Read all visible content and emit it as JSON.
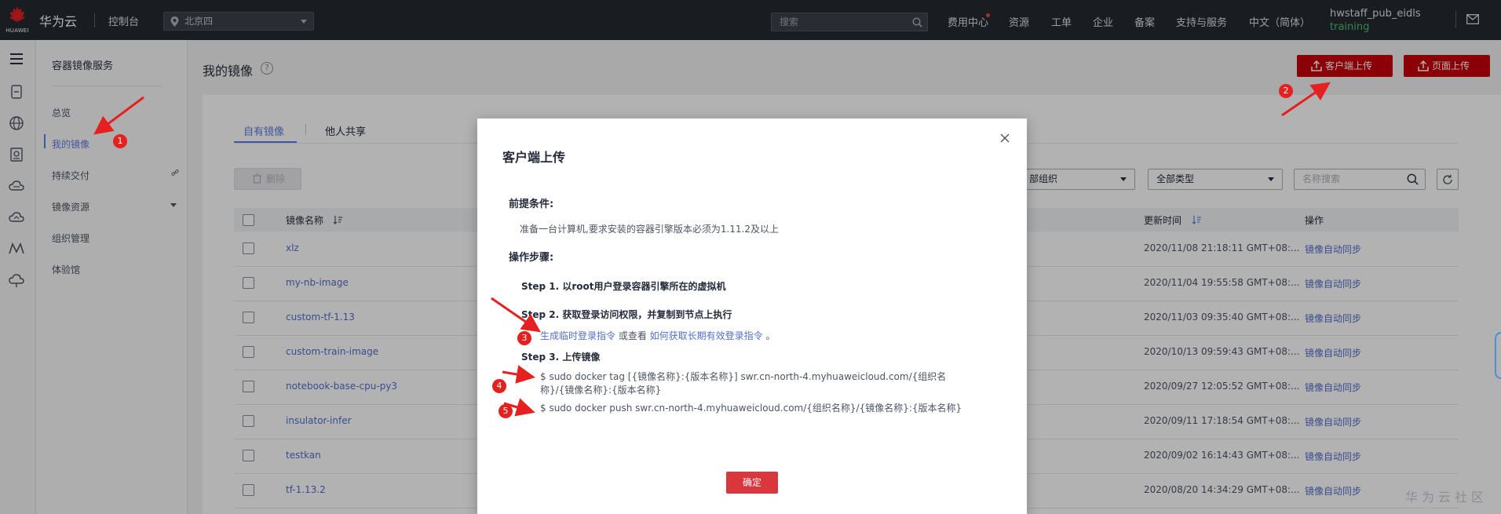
{
  "topbar": {
    "logo_text": "HUAWEI",
    "brand": "华为云",
    "console": "控制台",
    "region": "北京四",
    "search_placeholder": "搜索",
    "nav": [
      "费用中心",
      "资源",
      "工单",
      "企业",
      "备案",
      "支持与服务",
      "中文（简体）"
    ],
    "user_name": "hwstaff_pub_eidls",
    "user_role": "training"
  },
  "sidebar": {
    "title": "容器镜像服务",
    "items": [
      "总览",
      "我的镜像",
      "持续交付",
      "镜像资源",
      "组织管理",
      "体验馆"
    ],
    "active_index": 1
  },
  "main": {
    "title": "我的镜像",
    "help": "?",
    "client_upload": "客户端上传",
    "page_upload": "页面上传",
    "tabs": [
      "自有镜像",
      "他人共享"
    ],
    "delete_label": "删除",
    "org_filter": "部组织",
    "type_filter": "全部类型",
    "name_search_placeholder": "名称搜索",
    "columns": {
      "name": "镜像名称",
      "updated": "更新时间",
      "actions": "操作"
    },
    "rows": [
      {
        "name": "xlz",
        "updated": "2020/11/08 21:18:11 GMT+08:...",
        "action": "镜像自动同步"
      },
      {
        "name": "my-nb-image",
        "updated": "2020/11/04 19:55:58 GMT+08:...",
        "action": "镜像自动同步"
      },
      {
        "name": "custom-tf-1.13",
        "updated": "2020/11/03 09:35:40 GMT+08:...",
        "action": "镜像自动同步"
      },
      {
        "name": "custom-train-image",
        "updated": "2020/10/13 09:59:43 GMT+08:...",
        "action": "镜像自动同步"
      },
      {
        "name": "notebook-base-cpu-py3",
        "updated": "2020/09/27 12:05:52 GMT+08:...",
        "action": "镜像自动同步"
      },
      {
        "name": "insulator-infer",
        "updated": "2020/09/11 17:18:54 GMT+08:...",
        "action": "镜像自动同步"
      },
      {
        "name": "testkan",
        "updated": "2020/09/02 16:14:43 GMT+08:...",
        "action": "镜像自动同步"
      },
      {
        "name": "tf-1.13.2",
        "updated": "2020/08/20 14:34:29 GMT+08:...",
        "action": "镜像自动同步"
      }
    ]
  },
  "modal": {
    "title": "客户端上传",
    "prereq_heading": "前提条件:",
    "prereq_text": "准备一台计算机,要求安装的容器引擎版本必须为1.11.2及以上",
    "steps_heading": "操作步骤:",
    "step1": "Step 1. 以root用户登录容器引擎所在的虚拟机",
    "step2": "Step 2. 获取登录访问权限，并复制到节点上执行",
    "step2_link1": "生成临时登录指令",
    "step2_mid": " 或查看 ",
    "step2_link2": "如何获取长期有效登录指令",
    "step2_end": " 。",
    "step3": "Step 3. 上传镜像",
    "cmd1": "$ sudo docker tag [{镜像名称}:{版本名称}] swr.cn-north-4.myhuaweicloud.com/{组织名称}/{镜像名称}:{版本名称}",
    "cmd2": "$ sudo docker push swr.cn-north-4.myhuaweicloud.com/{组织名称}/{镜像名称}:{版本名称}",
    "ok": "确定"
  },
  "annotations": [
    "1",
    "2",
    "3",
    "4",
    "5"
  ],
  "watermark": "华为云社区",
  "colors": {
    "topbar": "#24292f",
    "primary": "#5e7ce0",
    "danger": "#c7000b",
    "annotation": "#e5211f"
  }
}
